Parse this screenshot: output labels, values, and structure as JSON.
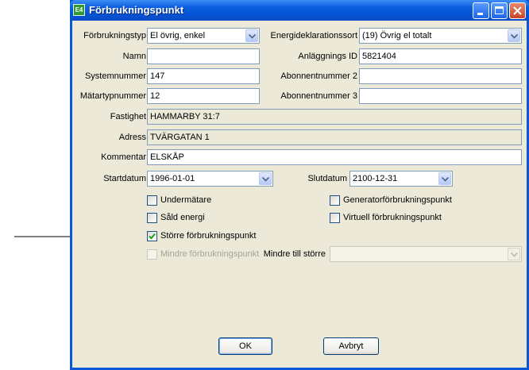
{
  "window": {
    "title": "Förbrukningspunkt",
    "icon_text": "E4"
  },
  "form": {
    "forbrukningstyp": {
      "label": "Förbrukningstyp",
      "value": "El övrig, enkel"
    },
    "energideklarationssort": {
      "label": "Energideklarationssort",
      "value": "(19) Övrig el totalt"
    },
    "namn": {
      "label": "Namn",
      "value": ""
    },
    "anlaggnings_id": {
      "label": "Anläggnings ID",
      "value": "5821404"
    },
    "systemnummer": {
      "label": "Systemnummer",
      "value": "147"
    },
    "abonnentnummer2": {
      "label": "Abonnentnummer 2",
      "value": ""
    },
    "matartypnummer": {
      "label": "Mätartypnummer",
      "value": "12"
    },
    "abonnentnummer3": {
      "label": "Abonnentnummer 3",
      "value": ""
    },
    "fastighet": {
      "label": "Fastighet",
      "value": "HAMMARBY 31:7"
    },
    "adress": {
      "label": "Adress",
      "value": "TVÄRGATAN 1"
    },
    "kommentar": {
      "label": "Kommentar",
      "value": "ELSKÅP"
    },
    "startdatum": {
      "label": "Startdatum",
      "value": "1996-01-01"
    },
    "slutdatum": {
      "label": "Slutdatum",
      "value": "2100-12-31"
    },
    "undermatare": {
      "label": "Undermätare",
      "checked": false
    },
    "generatorforbrukningspunkt": {
      "label": "Generatorförbrukningspunkt",
      "checked": false
    },
    "sald_energi": {
      "label": "Såld energi",
      "checked": false
    },
    "virtuell_forbrukningspunkt": {
      "label": "Virtuell förbrukningspunkt",
      "checked": false
    },
    "storre_forbrukningspunkt": {
      "label": "Större förbrukningspunkt",
      "checked": true
    },
    "mindre_forbrukningspunkt": {
      "label": "Mindre förbrukningspunkt",
      "checked": false,
      "disabled": true
    },
    "mindre_till_storre": {
      "label": "Mindre till större",
      "value": ""
    }
  },
  "buttons": {
    "ok": "OK",
    "cancel": "Avbryt"
  }
}
